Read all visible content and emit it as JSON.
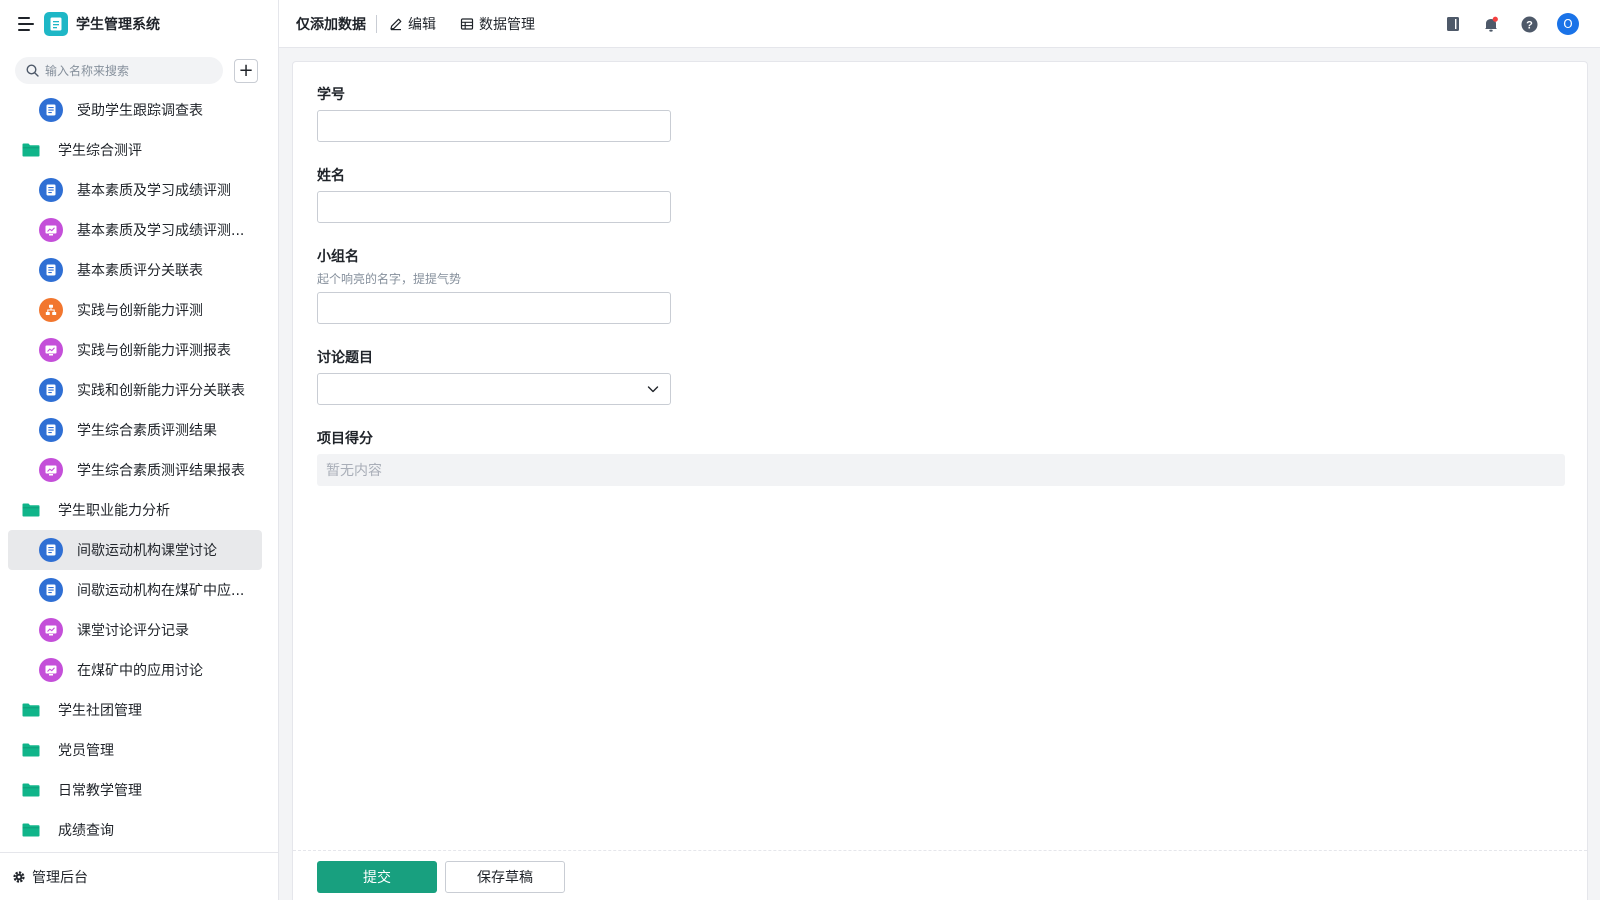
{
  "app": {
    "title": "学生管理系统",
    "logo_icon": "doc-icon",
    "logo_color": "#1eb7c6"
  },
  "search": {
    "placeholder": "输入名称来搜索",
    "add_label": "+"
  },
  "sidebar": {
    "items": [
      {
        "type": "form",
        "label": "受助学生跟踪调查表",
        "icon": "form-icon",
        "color": "blue"
      },
      {
        "type": "folder",
        "label": "学生综合测评",
        "icon": "folder-icon"
      },
      {
        "type": "form",
        "label": "基本素质及学习成绩评测",
        "icon": "form-icon",
        "color": "blue"
      },
      {
        "type": "report",
        "label": "基本素质及学习成绩评测...",
        "icon": "report-icon",
        "color": "purple"
      },
      {
        "type": "form",
        "label": "基本素质评分关联表",
        "icon": "form-icon",
        "color": "blue"
      },
      {
        "type": "flow",
        "label": "实践与创新能力评测",
        "icon": "flow-icon",
        "color": "orange"
      },
      {
        "type": "report",
        "label": "实践与创新能力评测报表",
        "icon": "report-icon",
        "color": "purple"
      },
      {
        "type": "form",
        "label": "实践和创新能力评分关联表",
        "icon": "form-icon",
        "color": "blue"
      },
      {
        "type": "form",
        "label": "学生综合素质评测结果",
        "icon": "form-icon",
        "color": "blue"
      },
      {
        "type": "report",
        "label": "学生综合素质测评结果报表",
        "icon": "report-icon",
        "color": "purple"
      },
      {
        "type": "folder",
        "label": "学生职业能力分析",
        "icon": "folder-icon"
      },
      {
        "type": "form",
        "label": "间歇运动机构课堂讨论",
        "icon": "form-icon",
        "color": "blue",
        "active": true
      },
      {
        "type": "form",
        "label": "间歇运动机构在煤矿中应...",
        "icon": "form-icon",
        "color": "blue"
      },
      {
        "type": "report",
        "label": "课堂讨论评分记录",
        "icon": "report-icon",
        "color": "purple"
      },
      {
        "type": "report",
        "label": "在煤矿中的应用讨论",
        "icon": "report-icon",
        "color": "purple"
      },
      {
        "type": "folder",
        "label": "学生社团管理",
        "icon": "folder-icon"
      },
      {
        "type": "folder",
        "label": "党员管理",
        "icon": "folder-icon"
      },
      {
        "type": "folder",
        "label": "日常教学管理",
        "icon": "folder-icon"
      },
      {
        "type": "folder",
        "label": "成绩查询",
        "icon": "folder-icon"
      }
    ],
    "footer_label": "管理后台"
  },
  "topbar": {
    "title": "仅添加数据",
    "edit_label": "编辑",
    "data_manage_label": "数据管理",
    "avatar_text": "O"
  },
  "form": {
    "fields": {
      "student_id": {
        "label": "学号",
        "value": ""
      },
      "name": {
        "label": "姓名",
        "value": ""
      },
      "group_name": {
        "label": "小组名",
        "hint": "起个响亮的名字，提提气势",
        "value": ""
      },
      "topic": {
        "label": "讨论题目",
        "value": ""
      },
      "score": {
        "label": "项目得分",
        "empty_text": "暂无内容"
      }
    },
    "submit_label": "提交",
    "draft_label": "保存草稿"
  },
  "colors": {
    "accent": "#18a07f",
    "folder": "#10b58a",
    "form_icon": "#2f6fd4",
    "report_icon": "#c44fd9",
    "flow_icon": "#f2762e"
  }
}
